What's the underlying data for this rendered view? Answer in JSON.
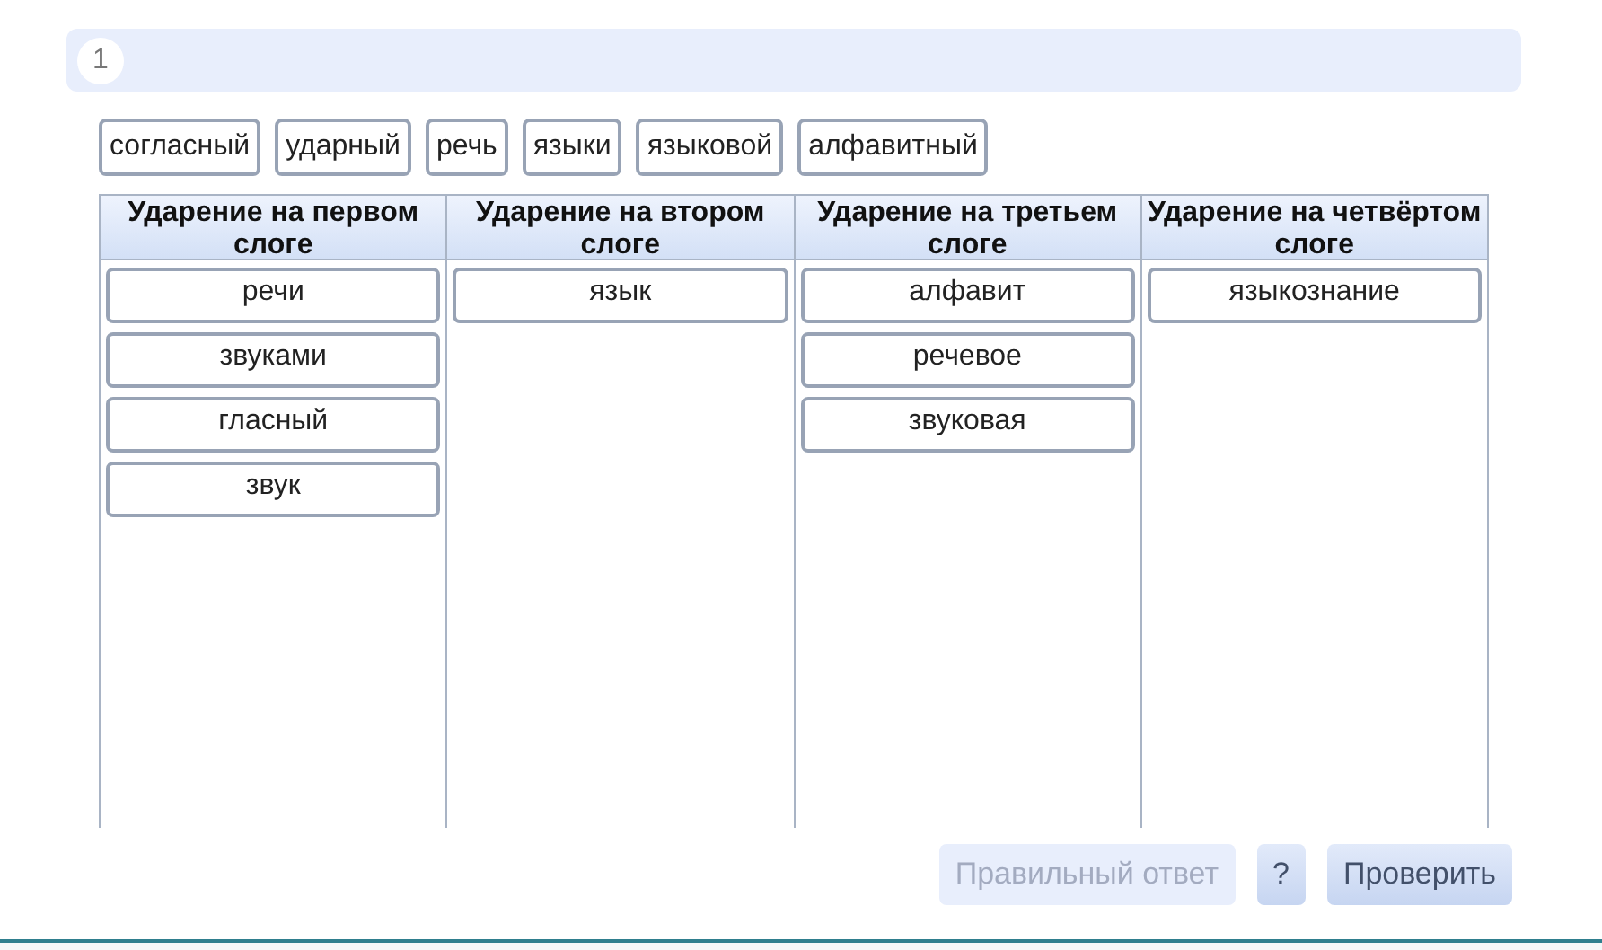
{
  "question": {
    "number": "1"
  },
  "word_bank": [
    "согласный",
    "ударный",
    "речь",
    "языки",
    "языковой",
    "алфавитный"
  ],
  "columns": [
    {
      "heading": "Ударение на первом слоге",
      "words": [
        "речи",
        "звуками",
        "гласный",
        "звук"
      ]
    },
    {
      "heading": "Ударение на втором слоге",
      "words": [
        "язык"
      ]
    },
    {
      "heading": "Ударение на третьем слоге",
      "words": [
        "алфавит",
        "речевое",
        "звуковая"
      ]
    },
    {
      "heading": "Ударение на четвёртом слоге",
      "words": [
        "языкознание"
      ]
    }
  ],
  "buttons": [
    {
      "label": "Правильный ответ",
      "disabled": true
    },
    {
      "label": "?",
      "disabled": false
    },
    {
      "label": "Проверить",
      "disabled": false
    }
  ]
}
